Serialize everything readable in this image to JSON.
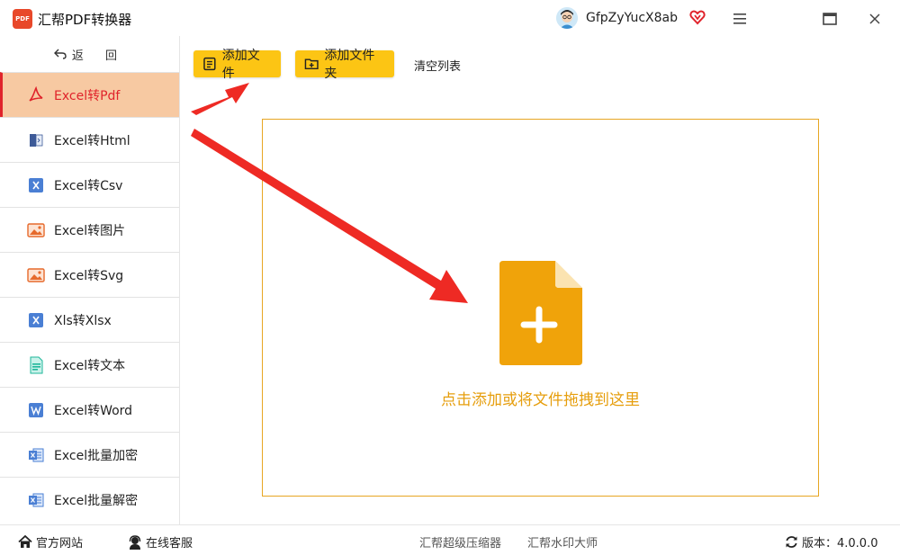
{
  "app": {
    "title": "汇帮PDF转换器",
    "logo_text": "PDF"
  },
  "user": {
    "name": "GfpZyYucX8ab"
  },
  "sidebar": {
    "back_label": "返 回",
    "items": [
      {
        "label": "Excel转Pdf",
        "icon": "pdf-icon",
        "active": true
      },
      {
        "label": "Excel转Html",
        "icon": "html-doc-icon"
      },
      {
        "label": "Excel转Csv",
        "icon": "excel-x-icon"
      },
      {
        "label": "Excel转图片",
        "icon": "image-icon"
      },
      {
        "label": "Excel转Svg",
        "icon": "image-icon"
      },
      {
        "label": "Xls转Xlsx",
        "icon": "excel-x-icon"
      },
      {
        "label": "Excel转文本",
        "icon": "text-doc-icon"
      },
      {
        "label": "Excel转Word",
        "icon": "word-icon"
      },
      {
        "label": "Excel批量加密",
        "icon": "excel-file-icon"
      },
      {
        "label": "Excel批量解密",
        "icon": "excel-file-icon"
      }
    ]
  },
  "toolbar": {
    "add_file": "添加文件",
    "add_folder": "添加文件夹",
    "clear_list": "清空列表"
  },
  "dropzone": {
    "hint": "点击添加或将文件拖拽到这里"
  },
  "footer": {
    "home": "官方网站",
    "service": "在线客服",
    "compress": "汇帮超级压缩器",
    "watermark": "汇帮水印大师",
    "version": "版本：4.0.0.0"
  },
  "colors": {
    "accent_yellow": "#fcc514",
    "active_bg": "#f7c9a2",
    "active_text": "#e0232b",
    "drop_border": "#e7a623",
    "drop_icon": "#f0a30a",
    "arrow_red": "#ee2a24"
  }
}
